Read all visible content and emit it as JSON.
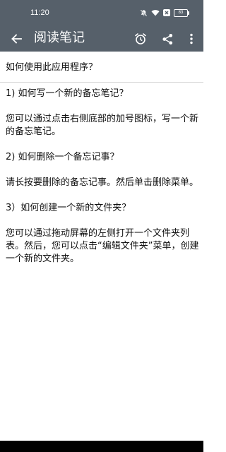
{
  "status_bar": {
    "time": "11:20",
    "battery": "83",
    "icons": [
      "mute-icon",
      "wifi-icon",
      "x-icon",
      "battery-icon"
    ]
  },
  "app_bar": {
    "title": "阅读笔记",
    "icons": [
      "back-arrow-icon",
      "alarm-icon",
      "share-icon",
      "more-vert-icon"
    ]
  },
  "note": {
    "title": "如何使用此应用程序？",
    "paragraphs": [
      "1) 如何写一个新的备忘笔记？",
      "您可以通过点击右侧底部的加号图标，写一个新的备忘笔记。",
      "2) 如何删除一个备忘记事？",
      "请长按要删除的备忘记事。然后单击删除菜单。",
      "3）如何创建一个新的文件夹？",
      "您可以通过拖动屏幕的左侧打开一个文件夹列表。然后，您可以点击“编辑文件夹”菜单，创建一个新的文件夹。"
    ]
  },
  "colors": {
    "app_bar": "#56606a",
    "text": "#111111",
    "background": "#ffffff"
  }
}
